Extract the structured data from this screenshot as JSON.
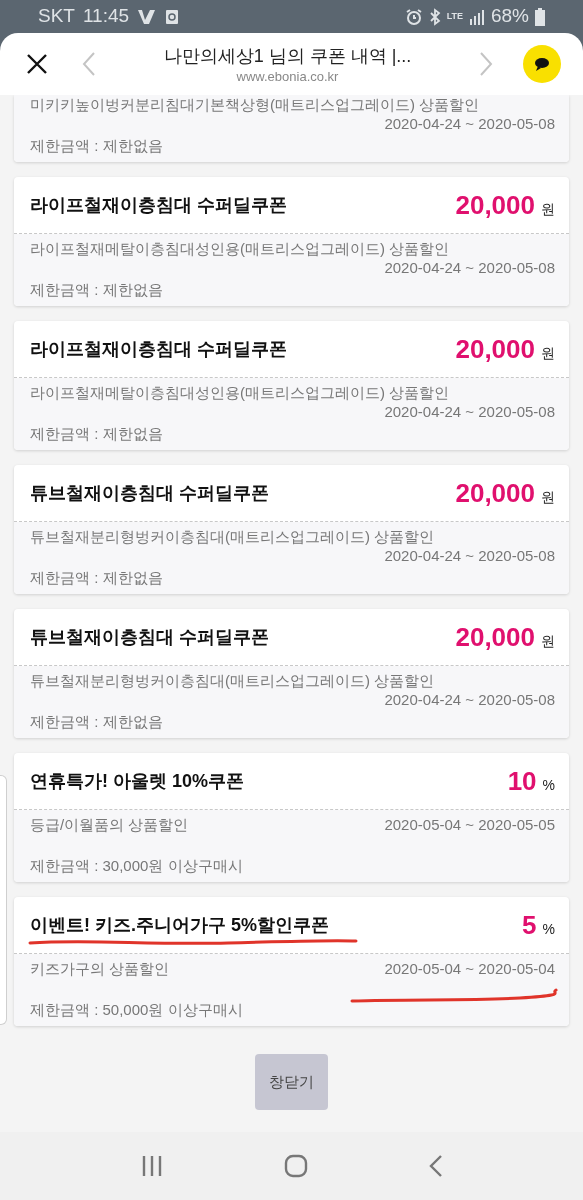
{
  "status_bar": {
    "carrier": "SKT",
    "time": "11:45",
    "network": "LTE",
    "battery": "68%"
  },
  "browser": {
    "title": "나만의세상1 님의 쿠폰 내역 |...",
    "url": "www.ebonia.co.kr"
  },
  "coupons": [
    {
      "description": "미키키높이벙커분리침대기본책상형(매트리스업그레이드) 상품할인",
      "period": "2020-04-24 ~ 2020-05-08",
      "limit": "제한금액 : 제한없음",
      "annotated": false
    },
    {
      "title": "라이프철재이층침대 수퍼딜쿠폰",
      "value": "20,000",
      "unit": "원",
      "description": "라이프철재메탈이층침대성인용(매트리스업그레이드) 상품할인",
      "period": "2020-04-24 ~ 2020-05-08",
      "limit": "제한금액 : 제한없음",
      "annotated": false
    },
    {
      "title": "라이프철재이층침대 수퍼딜쿠폰",
      "value": "20,000",
      "unit": "원",
      "description": "라이프철재메탈이층침대성인용(매트리스업그레이드) 상품할인",
      "period": "2020-04-24 ~ 2020-05-08",
      "limit": "제한금액 : 제한없음",
      "annotated": false
    },
    {
      "title": "튜브철재이층침대 수퍼딜쿠폰",
      "value": "20,000",
      "unit": "원",
      "description": "튜브철재분리형벙커이층침대(매트리스업그레이드) 상품할인",
      "period": "2020-04-24 ~ 2020-05-08",
      "limit": "제한금액 : 제한없음",
      "annotated": false
    },
    {
      "title": "튜브철재이층침대 수퍼딜쿠폰",
      "value": "20,000",
      "unit": "원",
      "description": "튜브철재분리형벙커이층침대(매트리스업그레이드) 상품할인",
      "period": "2020-04-24 ~ 2020-05-08",
      "limit": "제한금액 : 제한없음",
      "annotated": false
    },
    {
      "title": "연휴특가! 아울렛 10%쿠폰",
      "value": "10",
      "unit": "%",
      "description": "등급/이월품의 상품할인",
      "period": "2020-05-04 ~ 2020-05-05",
      "limit": "제한금액 : 30,000원 이상구매시",
      "annotated": false
    },
    {
      "title": "이벤트! 키즈.주니어가구 5%할인쿠폰",
      "value": "5",
      "unit": "%",
      "description": "키즈가구의 상품할인",
      "period": "2020-05-04 ~ 2020-05-04",
      "limit": "제한금액 : 50,000원 이상구매시",
      "annotated": true
    }
  ],
  "close_button": "창닫기"
}
